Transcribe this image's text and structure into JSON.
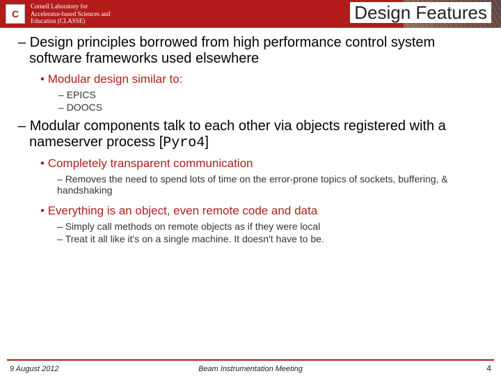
{
  "header": {
    "logo_letter": "C",
    "lab_line1": "Cornell Laboratory for",
    "lab_line2": "Accelerator-based Sciences and",
    "lab_line3": "Education (CLASSE)",
    "title": "Design Features"
  },
  "body": {
    "p1": "Design principles borrowed from high performance control system software frameworks used elsewhere",
    "p1_sub1": "Modular design similar to:",
    "p1_sub1_a": "EPICS",
    "p1_sub1_b": "DOOCS",
    "p2_part1": "Modular components talk to each other via objects registered with a nameserver process [",
    "p2_code": "Pyro4",
    "p2_part2": "]",
    "p2_sub1": "Completely transparent communication",
    "p2_sub1_a": "Removes the need to spend lots of time on the error-prone topics of sockets, buffering, & handshaking",
    "p2_sub2": "Everything is an object, even remote code and data",
    "p2_sub2_a": "Simply call methods on remote objects as if they were local",
    "p2_sub2_b": "Treat it all like it's on a single machine. It doesn't have to be."
  },
  "footer": {
    "date": "9 August 2012",
    "meeting": "Beam Instrumentation Meeting",
    "page": "4"
  }
}
